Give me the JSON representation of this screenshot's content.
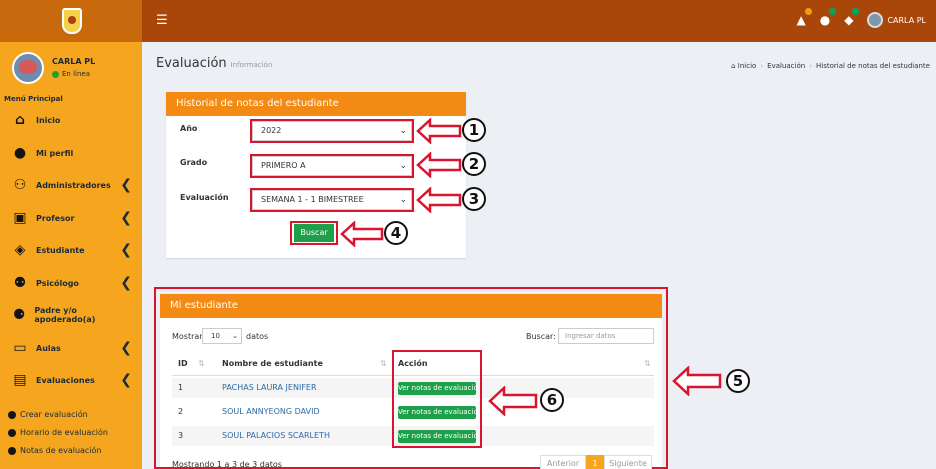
{
  "topbar": {
    "menu_icon": "☰",
    "user_name": "CARLA PL",
    "badge_colors": [
      "#f39c12",
      "#00a65a",
      "#00a65a"
    ]
  },
  "sidebar": {
    "user": {
      "name": "CARLA PL",
      "status": "En línea"
    },
    "menu_header": "Menú Principal",
    "items": [
      {
        "label": "Inicio",
        "icon": "home-icon",
        "glyph": "⌂",
        "has_arrow": false
      },
      {
        "label": "Mi perfil",
        "icon": "user-icon",
        "glyph": "●",
        "has_arrow": false
      },
      {
        "label": "Administradores",
        "icon": "users-icon",
        "glyph": "⚇",
        "has_arrow": true
      },
      {
        "label": "Profesor",
        "icon": "teacher-icon",
        "glyph": "▣",
        "has_arrow": true
      },
      {
        "label": "Estudiante",
        "icon": "student-icon",
        "glyph": "◈",
        "has_arrow": true
      },
      {
        "label": "Psicólogo",
        "icon": "psychologist-icon",
        "glyph": "⚉",
        "has_arrow": true
      },
      {
        "label": "Padre y/o apoderado(a)",
        "icon": "family-icon",
        "glyph": "⚈",
        "has_arrow": false
      },
      {
        "label": "Aulas",
        "icon": "classroom-icon",
        "glyph": "▭",
        "has_arrow": true
      },
      {
        "label": "Evaluaciones",
        "icon": "evaluations-icon",
        "glyph": "▤",
        "has_arrow": true
      }
    ],
    "sub_items": [
      "Crear evaluación",
      "Horario de evaluación",
      "Notas de evaluación"
    ],
    "arrow_glyph": "❮"
  },
  "page": {
    "title": "Evaluación",
    "subtitle": "Información",
    "breadcrumb": [
      "Inicio",
      "Evaluación",
      "Historial de notas del estudiante"
    ]
  },
  "filter_box": {
    "title": "Historial de notas del estudiante",
    "fields": [
      {
        "label": "Año",
        "value": "2022"
      },
      {
        "label": "Grado",
        "value": "PRIMERO A"
      },
      {
        "label": "Evaluación",
        "value": "SEMANA 1 - 1 BIMESTREE"
      }
    ],
    "button": "Buscar"
  },
  "students_box": {
    "title": "Mi estudiante",
    "show_label": "Mostrar",
    "show_value": "10",
    "show_suffix": "datos",
    "search_label": "Buscar:",
    "search_placeholder": "Ingresar datos",
    "columns": [
      "ID",
      "Nombre de estudiante",
      "Acción"
    ],
    "rows": [
      {
        "id": "1",
        "name": "PACHAS LAURA JENIFER",
        "action": "Ver notas de evaluación"
      },
      {
        "id": "2",
        "name": "SOUL ANNYEONG DAVID",
        "action": "Ver notas de evaluación"
      },
      {
        "id": "3",
        "name": "SOUL PALACIOS SCARLETH",
        "action": "Ver notas de evaluación"
      }
    ],
    "info": "Mostrando 1 a 3 de 3 datos",
    "pager": {
      "prev": "Anterior",
      "current": "1",
      "next": "Siguiente"
    }
  },
  "annotations": [
    "1",
    "2",
    "3",
    "4",
    "5",
    "6"
  ],
  "colors": {
    "sidebar": "#f6a61e",
    "topbar": "#a9470a",
    "accent": "#f28a13",
    "success": "#1ea04a",
    "highlight": "#d9142e"
  }
}
